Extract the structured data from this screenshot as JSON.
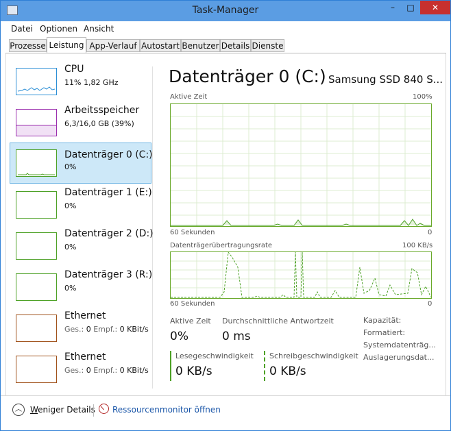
{
  "window": {
    "title": "Task-Manager",
    "controls": {
      "minimize": "–",
      "maximize": "□",
      "close": "✕"
    },
    "accent_color": "#5b9de3"
  },
  "menu": [
    "Datei",
    "Optionen",
    "Ansicht"
  ],
  "tabs": [
    {
      "label": "Prozesse",
      "active": false
    },
    {
      "label": "Leistung",
      "active": true
    },
    {
      "label": "App-Verlauf",
      "active": false
    },
    {
      "label": "Autostart",
      "active": false
    },
    {
      "label": "Benutzer",
      "active": false
    },
    {
      "label": "Details",
      "active": false
    },
    {
      "label": "Dienste",
      "active": false
    }
  ],
  "sidebar": [
    {
      "name": "CPU",
      "sub": "11%  1,82 GHz",
      "color": "#2c8fd6",
      "selected": false
    },
    {
      "name": "Arbeitsspeicher",
      "sub": "6,3/16,0 GB (39%)",
      "color": "#9b2fae",
      "selected": false
    },
    {
      "name": "Datenträger 0 (C:)",
      "sub": "0%",
      "color": "#4da126",
      "selected": true
    },
    {
      "name": "Datenträger 1 (E:)",
      "sub": "0%",
      "color": "#4da126",
      "selected": false
    },
    {
      "name": "Datenträger 2 (D:)",
      "sub": "0%",
      "color": "#4da126",
      "selected": false
    },
    {
      "name": "Datenträger 3 (R:)",
      "sub": "0%",
      "color": "#4da126",
      "selected": false
    },
    {
      "name": "Ethernet",
      "sub_label1": "Ges.:",
      "sub_value1": "0",
      "sub_label2": "Empf.:",
      "sub_value2": "0 KBit/s",
      "color": "#a0521b",
      "selected": false
    },
    {
      "name": "Ethernet",
      "sub_label1": "Ges.:",
      "sub_value1": "0",
      "sub_label2": "Empf.:",
      "sub_value2": "0 KBit/s",
      "color": "#a0521b",
      "selected": false
    }
  ],
  "detail": {
    "title": "Datenträger 0 (C:)",
    "model": "Samsung SSD 840 S...",
    "graph1": {
      "label": "Aktive Zeit",
      "max": "100%",
      "time": "60 Sekunden",
      "min": "0"
    },
    "graph2": {
      "label": "Datenträgerübertragungsrate",
      "max": "100 KB/s",
      "time": "60 Sekunden",
      "min": "0"
    },
    "stats": {
      "active_label": "Aktive Zeit",
      "active_value": "0%",
      "response_label": "Durchschnittliche Antwortzeit",
      "response_value": "0 ms",
      "read_label": "Lesegeschwindigkeit",
      "read_value": "0 KB/s",
      "write_label": "Schreibgeschwindigkeit",
      "write_value": "0 KB/s"
    },
    "properties": [
      "Kapazität:",
      "Formatiert:",
      "Systemdatenträg...",
      "Auslagerungsdat..."
    ]
  },
  "footer": {
    "less_details": "Weniger Details",
    "resource_monitor": "Ressourcenmonitor öffnen"
  }
}
